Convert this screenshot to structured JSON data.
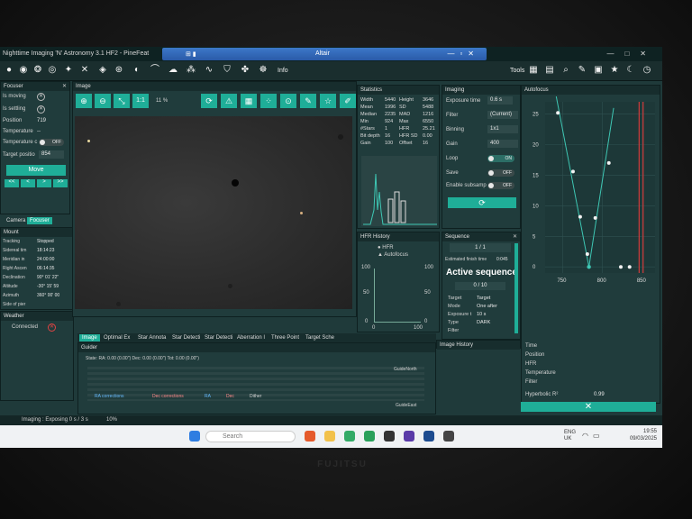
{
  "window": {
    "app_title": "Nighttime Imaging 'N' Astronomy 3.1 HF2 - PineFeat",
    "remote_title": "Altair"
  },
  "toolbar": {
    "info_label": "Info",
    "tools_label": "Tools"
  },
  "focuser": {
    "title": "Focuser",
    "rows": [
      {
        "label": "Is moving"
      },
      {
        "label": "Is settling"
      },
      {
        "label": "Position",
        "value": "719"
      },
      {
        "label": "Temperature",
        "value": "--"
      },
      {
        "label": "Temperature c",
        "value": "OFF"
      }
    ],
    "target_label": "Target positio",
    "target_value": "854",
    "move_label": "Move",
    "step_buttons": [
      "<<",
      "<",
      ">",
      ">>"
    ]
  },
  "left_tabs": [
    "Camera",
    "Focuser"
  ],
  "mount": {
    "title": "Mount",
    "rows": [
      {
        "label": "Tracking",
        "value": "Stopped"
      },
      {
        "label": "Sidereal tim",
        "value": "18:14:23"
      },
      {
        "label": "Meridian in",
        "value": "24:00:00"
      },
      {
        "label": "Right Ascen",
        "value": "06:14:35"
      },
      {
        "label": "Declination",
        "value": "90° 01' 22\""
      },
      {
        "label": "Altitude",
        "value": "-30° 15' 59"
      },
      {
        "label": "Azimuth",
        "value": "360° 00' 00"
      },
      {
        "label": "Side of pier",
        "value": ""
      }
    ]
  },
  "weather": {
    "title": "Weather",
    "status": "Connected"
  },
  "image_panel": {
    "title": "Image",
    "zoom_label": "1:1",
    "zoom_pct": "11 %",
    "bottom_tabs": [
      "Image",
      "Optimal Ex",
      "Star Annota",
      "Star Detecti",
      "Star Detecti",
      "Aberration I",
      "Three Point",
      "Target Sche"
    ]
  },
  "statistics": {
    "title": "Statistics",
    "rows": [
      {
        "l1": "Width",
        "v1": "5440",
        "l2": "Height",
        "v2": "3646"
      },
      {
        "l1": "Mean",
        "v1": "1996",
        "l2": "SD",
        "v2": "5488"
      },
      {
        "l1": "Median",
        "v1": "2235",
        "l2": "MAD",
        "v2": "1216"
      },
      {
        "l1": "Min",
        "v1": "924",
        "l2": "Max",
        "v2": "6550"
      },
      {
        "l1": "#Stars",
        "v1": "1",
        "l2": "HFR",
        "v2": "25.21"
      },
      {
        "l1": "Bit depth",
        "v1": "16",
        "l2": "HFR SD",
        "v2": "0.00"
      },
      {
        "l1": "Gain",
        "v1": "100",
        "l2": "Offset",
        "v2": "16"
      }
    ]
  },
  "imaging": {
    "title": "Imaging",
    "exposure_label": "Exposure time",
    "exposure_value": "0.6",
    "exposure_unit": "s",
    "filter_label": "Filter",
    "filter_value": "(Current)",
    "binning_label": "Binning",
    "binning_value": "1x1",
    "gain_label": "Gain",
    "gain_value": "400",
    "loop_label": "Loop",
    "loop_value": "ON",
    "save_label": "Save",
    "save_value": "OFF",
    "subsample_label": "Enable subsamp",
    "subsample_value": "OFF"
  },
  "hfr_history": {
    "title": "HFR History",
    "legend": [
      "HFR",
      "Autofocus"
    ],
    "y_ticks": [
      "100",
      "50",
      "0"
    ],
    "y_ticks_right": [
      "100",
      "50",
      "0"
    ],
    "x_ticks": [
      "0",
      "100"
    ]
  },
  "sequence": {
    "title": "Sequence",
    "count": "1 / 1",
    "finish_label": "Estimated finish time",
    "finish_value": "0:045",
    "active_label": "Active sequence",
    "progress": "0 / 10",
    "rows": [
      {
        "l": "Target",
        "v": "Target"
      },
      {
        "l": "Mode",
        "v": "One after"
      },
      {
        "l": "Exposure t",
        "v": "10 s"
      },
      {
        "l": "Type",
        "v": "DARK"
      },
      {
        "l": "Filter",
        "v": ""
      }
    ]
  },
  "image_history": {
    "title": "Image History"
  },
  "guider": {
    "title": "Guider",
    "state_text": "State:  RA: 0.00 (0.00\")  Dec: 0.00 (0.00\")  Tot: 0.00 (0.00\")",
    "label_north": "GuideNorth",
    "label_east": "GuideEast",
    "legend": [
      "RA corrections",
      "Dec corrections",
      "RA",
      "Dec",
      "Dither"
    ]
  },
  "autofocus": {
    "title": "Autofocus",
    "info_rows": [
      {
        "label": "Time",
        "value": ""
      },
      {
        "label": "Position",
        "value": ""
      },
      {
        "label": "HFR",
        "value": ""
      },
      {
        "label": "Temperature",
        "value": ""
      },
      {
        "label": "Filter",
        "value": ""
      }
    ],
    "hyperbolic_label": "Hyperbolic R²",
    "hyperbolic_value": "0.99"
  },
  "chart_data": {
    "type": "scatter",
    "y_ticks": [
      "25",
      "20",
      "15",
      "10",
      "5",
      "0"
    ],
    "x_ticks": [
      "750",
      "800",
      "850"
    ],
    "xlim": [
      728,
      866
    ],
    "ylim": [
      -1,
      27
    ],
    "points": [
      {
        "x": 744,
        "y": 25.2
      },
      {
        "x": 763,
        "y": 15.6
      },
      {
        "x": 772,
        "y": 8.2
      },
      {
        "x": 781,
        "y": 2.1
      },
      {
        "x": 791,
        "y": 8.0
      },
      {
        "x": 808,
        "y": 17.0
      },
      {
        "x": 823,
        "y": 0.0
      },
      {
        "x": 834,
        "y": 0.0
      }
    ],
    "fit_min": {
      "x": 783,
      "y": 0.0
    },
    "markers_x": [
      846,
      851
    ]
  },
  "status_bar": {
    "left_text": "Imaging : Exposing 0 s / 3 s",
    "pct_text": "10%"
  },
  "taskbar": {
    "search_placeholder": "Search",
    "lang_top": "ENG",
    "lang_bottom": "UK",
    "time": "19:55",
    "date": "09/03/2025"
  },
  "brand": "FUJITSU",
  "colors": {
    "accent": "#1fae98",
    "panel": "#203c3c",
    "titlebar": "#0e2222",
    "remote_bar": "#3c78c8"
  }
}
